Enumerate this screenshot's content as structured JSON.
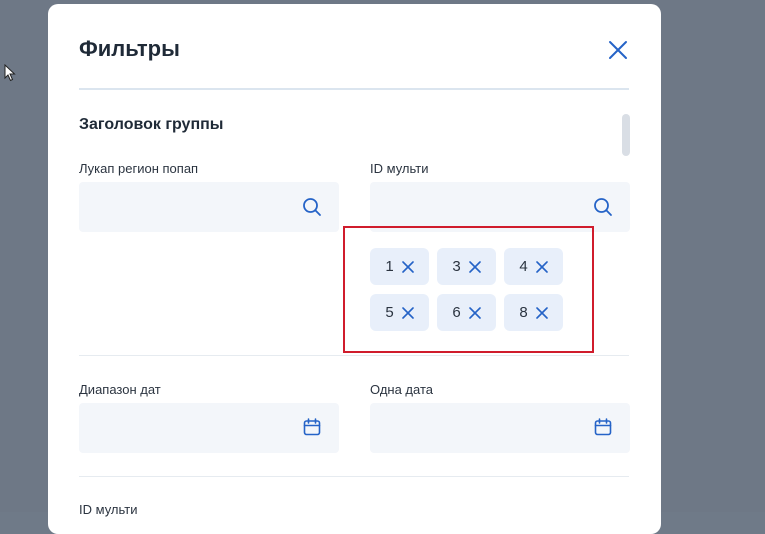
{
  "modal": {
    "title": "Фильтры",
    "group_title": "Заголовок группы"
  },
  "fields": {
    "lookup_label": "Лукап регион попап",
    "lookup_value": "",
    "id_multi_label": "ID мульти",
    "id_multi_value": "",
    "date_range_label": "Диапазон дат",
    "date_range_value": "",
    "single_date_label": "Одна дата",
    "single_date_value": "",
    "id_multi_2_label": "ID мульти"
  },
  "chips": [
    "1",
    "3",
    "4",
    "5",
    "6",
    "8"
  ],
  "icons": {
    "close": "close-icon",
    "search": "search-icon",
    "calendar": "calendar-icon"
  },
  "colors": {
    "accent": "#2563c7",
    "highlight": "#d01c2c",
    "field_bg": "#f3f6fa",
    "chip_bg": "#e8effa"
  }
}
